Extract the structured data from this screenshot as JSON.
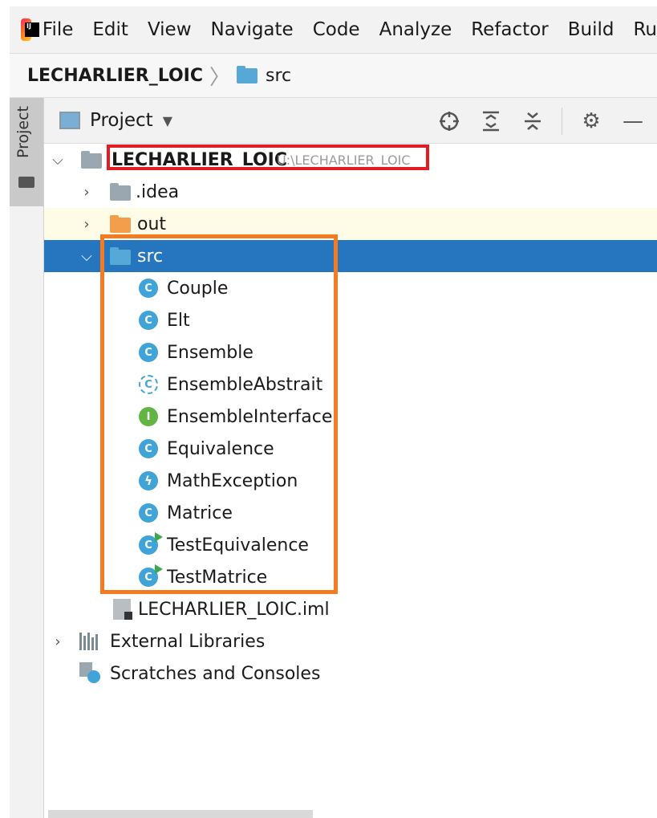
{
  "menubar": {
    "items": [
      "File",
      "Edit",
      "View",
      "Navigate",
      "Code",
      "Analyze",
      "Refactor",
      "Build",
      "Ru"
    ]
  },
  "navbar": {
    "project": "LECHARLIER_LOIC",
    "folder": "src"
  },
  "side_strip": {
    "tab_label": "Project"
  },
  "panel": {
    "title": "Project",
    "toolbar_icons": [
      "locate-icon",
      "expand-all-icon",
      "collapse-all-icon",
      "gear-icon",
      "minimize-icon"
    ]
  },
  "tree": {
    "root": {
      "name": "LECHARLIER_LOIC",
      "path": "U:\\LECHARLIER_LOIC"
    },
    "idea": ".idea",
    "out": "out",
    "src": "src",
    "classes": [
      {
        "name": "Couple",
        "kind": "class"
      },
      {
        "name": "Elt",
        "kind": "class"
      },
      {
        "name": "Ensemble",
        "kind": "class"
      },
      {
        "name": "EnsembleAbstrait",
        "kind": "abstract"
      },
      {
        "name": "EnsembleInterface",
        "kind": "interface"
      },
      {
        "name": "Equivalence",
        "kind": "class"
      },
      {
        "name": "MathException",
        "kind": "exception"
      },
      {
        "name": "Matrice",
        "kind": "class"
      },
      {
        "name": "TestEquivalence",
        "kind": "test"
      },
      {
        "name": "TestMatrice",
        "kind": "test"
      }
    ],
    "iml": "LECHARLIER_LOIC.iml",
    "external_libraries": "External Libraries",
    "scratches": "Scratches and Consoles"
  },
  "colors": {
    "selection": "#2675bf",
    "highlight_red": "#e31b23",
    "highlight_orange": "#f47b22",
    "class_icon": "#40a4d8",
    "interface_icon": "#62b543"
  }
}
